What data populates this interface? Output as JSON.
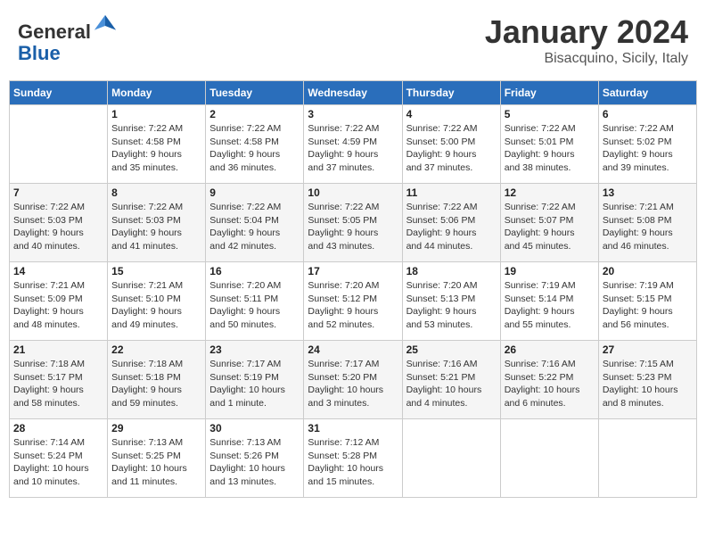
{
  "header": {
    "logo": {
      "general": "General",
      "blue": "Blue"
    },
    "month": "January 2024",
    "location": "Bisacquino, Sicily, Italy"
  },
  "days_of_week": [
    "Sunday",
    "Monday",
    "Tuesday",
    "Wednesday",
    "Thursday",
    "Friday",
    "Saturday"
  ],
  "weeks": [
    [
      {
        "day": null,
        "data": null
      },
      {
        "day": "1",
        "data": [
          "Sunrise: 7:22 AM",
          "Sunset: 4:58 PM",
          "Daylight: 9 hours",
          "and 35 minutes."
        ]
      },
      {
        "day": "2",
        "data": [
          "Sunrise: 7:22 AM",
          "Sunset: 4:58 PM",
          "Daylight: 9 hours",
          "and 36 minutes."
        ]
      },
      {
        "day": "3",
        "data": [
          "Sunrise: 7:22 AM",
          "Sunset: 4:59 PM",
          "Daylight: 9 hours",
          "and 37 minutes."
        ]
      },
      {
        "day": "4",
        "data": [
          "Sunrise: 7:22 AM",
          "Sunset: 5:00 PM",
          "Daylight: 9 hours",
          "and 37 minutes."
        ]
      },
      {
        "day": "5",
        "data": [
          "Sunrise: 7:22 AM",
          "Sunset: 5:01 PM",
          "Daylight: 9 hours",
          "and 38 minutes."
        ]
      },
      {
        "day": "6",
        "data": [
          "Sunrise: 7:22 AM",
          "Sunset: 5:02 PM",
          "Daylight: 9 hours",
          "and 39 minutes."
        ]
      }
    ],
    [
      {
        "day": "7",
        "data": [
          "Sunrise: 7:22 AM",
          "Sunset: 5:03 PM",
          "Daylight: 9 hours",
          "and 40 minutes."
        ]
      },
      {
        "day": "8",
        "data": [
          "Sunrise: 7:22 AM",
          "Sunset: 5:03 PM",
          "Daylight: 9 hours",
          "and 41 minutes."
        ]
      },
      {
        "day": "9",
        "data": [
          "Sunrise: 7:22 AM",
          "Sunset: 5:04 PM",
          "Daylight: 9 hours",
          "and 42 minutes."
        ]
      },
      {
        "day": "10",
        "data": [
          "Sunrise: 7:22 AM",
          "Sunset: 5:05 PM",
          "Daylight: 9 hours",
          "and 43 minutes."
        ]
      },
      {
        "day": "11",
        "data": [
          "Sunrise: 7:22 AM",
          "Sunset: 5:06 PM",
          "Daylight: 9 hours",
          "and 44 minutes."
        ]
      },
      {
        "day": "12",
        "data": [
          "Sunrise: 7:22 AM",
          "Sunset: 5:07 PM",
          "Daylight: 9 hours",
          "and 45 minutes."
        ]
      },
      {
        "day": "13",
        "data": [
          "Sunrise: 7:21 AM",
          "Sunset: 5:08 PM",
          "Daylight: 9 hours",
          "and 46 minutes."
        ]
      }
    ],
    [
      {
        "day": "14",
        "data": [
          "Sunrise: 7:21 AM",
          "Sunset: 5:09 PM",
          "Daylight: 9 hours",
          "and 48 minutes."
        ]
      },
      {
        "day": "15",
        "data": [
          "Sunrise: 7:21 AM",
          "Sunset: 5:10 PM",
          "Daylight: 9 hours",
          "and 49 minutes."
        ]
      },
      {
        "day": "16",
        "data": [
          "Sunrise: 7:20 AM",
          "Sunset: 5:11 PM",
          "Daylight: 9 hours",
          "and 50 minutes."
        ]
      },
      {
        "day": "17",
        "data": [
          "Sunrise: 7:20 AM",
          "Sunset: 5:12 PM",
          "Daylight: 9 hours",
          "and 52 minutes."
        ]
      },
      {
        "day": "18",
        "data": [
          "Sunrise: 7:20 AM",
          "Sunset: 5:13 PM",
          "Daylight: 9 hours",
          "and 53 minutes."
        ]
      },
      {
        "day": "19",
        "data": [
          "Sunrise: 7:19 AM",
          "Sunset: 5:14 PM",
          "Daylight: 9 hours",
          "and 55 minutes."
        ]
      },
      {
        "day": "20",
        "data": [
          "Sunrise: 7:19 AM",
          "Sunset: 5:15 PM",
          "Daylight: 9 hours",
          "and 56 minutes."
        ]
      }
    ],
    [
      {
        "day": "21",
        "data": [
          "Sunrise: 7:18 AM",
          "Sunset: 5:17 PM",
          "Daylight: 9 hours",
          "and 58 minutes."
        ]
      },
      {
        "day": "22",
        "data": [
          "Sunrise: 7:18 AM",
          "Sunset: 5:18 PM",
          "Daylight: 9 hours",
          "and 59 minutes."
        ]
      },
      {
        "day": "23",
        "data": [
          "Sunrise: 7:17 AM",
          "Sunset: 5:19 PM",
          "Daylight: 10 hours",
          "and 1 minute."
        ]
      },
      {
        "day": "24",
        "data": [
          "Sunrise: 7:17 AM",
          "Sunset: 5:20 PM",
          "Daylight: 10 hours",
          "and 3 minutes."
        ]
      },
      {
        "day": "25",
        "data": [
          "Sunrise: 7:16 AM",
          "Sunset: 5:21 PM",
          "Daylight: 10 hours",
          "and 4 minutes."
        ]
      },
      {
        "day": "26",
        "data": [
          "Sunrise: 7:16 AM",
          "Sunset: 5:22 PM",
          "Daylight: 10 hours",
          "and 6 minutes."
        ]
      },
      {
        "day": "27",
        "data": [
          "Sunrise: 7:15 AM",
          "Sunset: 5:23 PM",
          "Daylight: 10 hours",
          "and 8 minutes."
        ]
      }
    ],
    [
      {
        "day": "28",
        "data": [
          "Sunrise: 7:14 AM",
          "Sunset: 5:24 PM",
          "Daylight: 10 hours",
          "and 10 minutes."
        ]
      },
      {
        "day": "29",
        "data": [
          "Sunrise: 7:13 AM",
          "Sunset: 5:25 PM",
          "Daylight: 10 hours",
          "and 11 minutes."
        ]
      },
      {
        "day": "30",
        "data": [
          "Sunrise: 7:13 AM",
          "Sunset: 5:26 PM",
          "Daylight: 10 hours",
          "and 13 minutes."
        ]
      },
      {
        "day": "31",
        "data": [
          "Sunrise: 7:12 AM",
          "Sunset: 5:28 PM",
          "Daylight: 10 hours",
          "and 15 minutes."
        ]
      },
      {
        "day": null,
        "data": null
      },
      {
        "day": null,
        "data": null
      },
      {
        "day": null,
        "data": null
      }
    ]
  ]
}
